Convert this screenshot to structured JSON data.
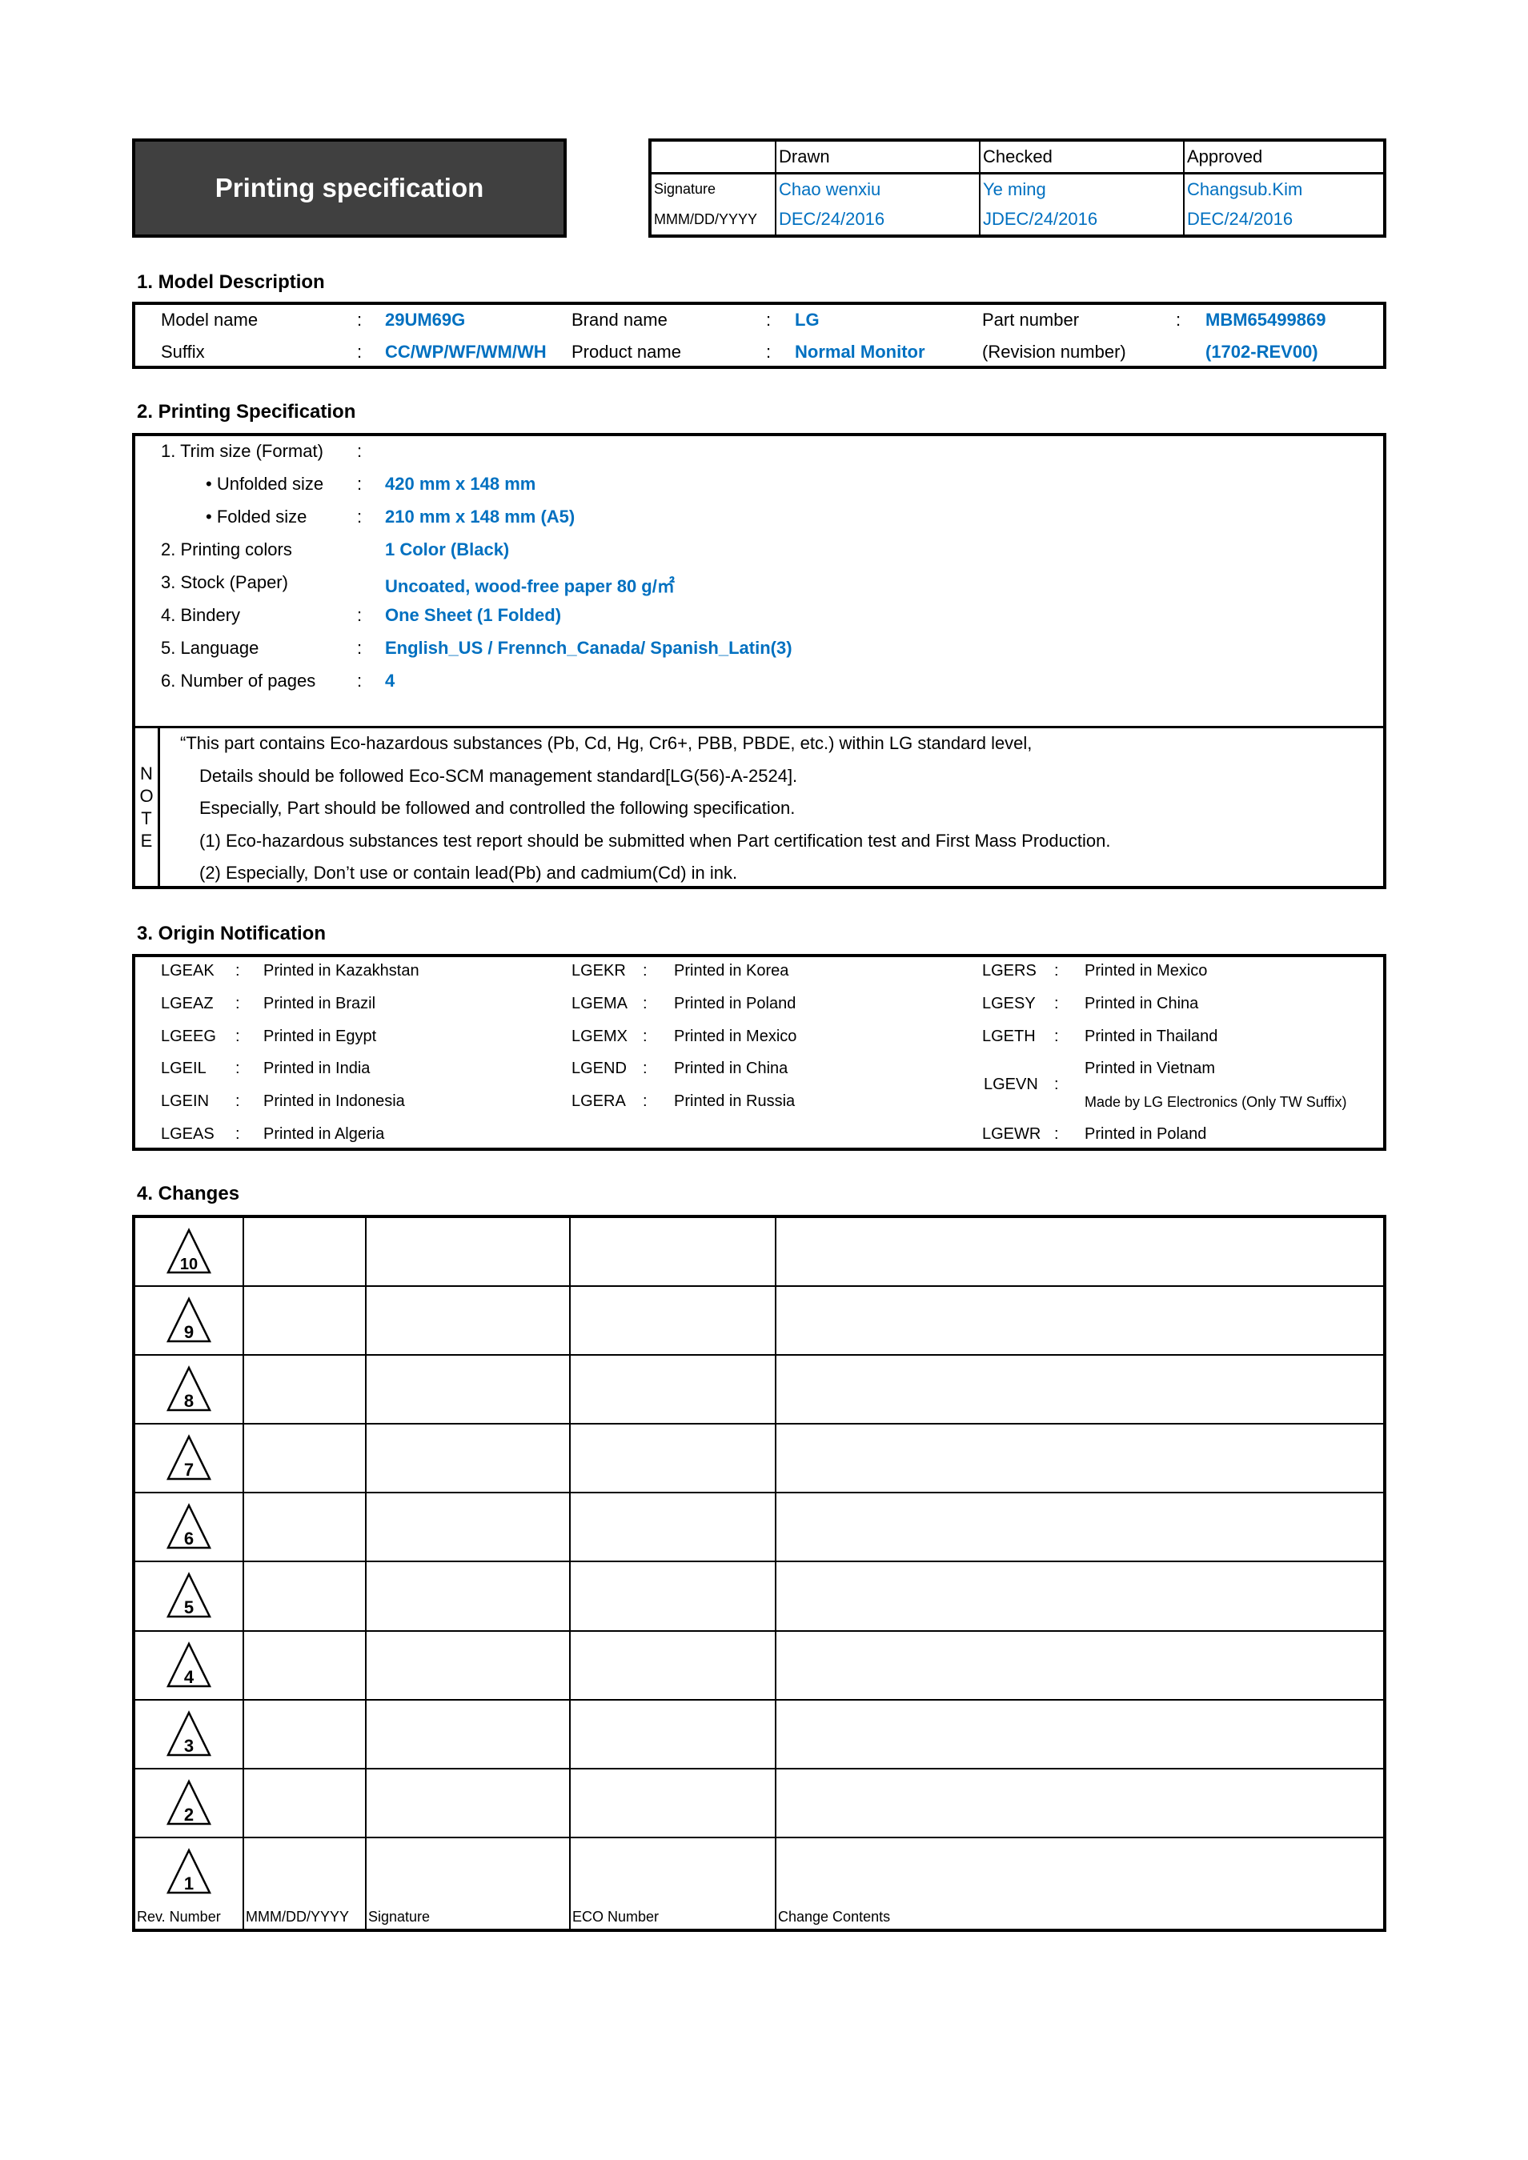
{
  "header": {
    "title": "Printing specification",
    "sign_table": {
      "columns": [
        "",
        "Drawn",
        "Checked",
        "Approved"
      ],
      "rows": [
        {
          "label": "Signature",
          "values": [
            "Chao wenxiu",
            "Ye ming",
            "Changsub.Kim"
          ]
        },
        {
          "label": "MMM/DD/YYYY",
          "values": [
            "DEC/24/2016",
            "JDEC/24/2016",
            "DEC/24/2016"
          ]
        }
      ]
    }
  },
  "model_description": {
    "heading": "1. Model Description",
    "rows": [
      [
        {
          "label": "Model name",
          "value": "29UM69G"
        },
        {
          "label": "Brand name",
          "value": "LG"
        },
        {
          "label": "Part number",
          "value": "MBM65499869"
        }
      ],
      [
        {
          "label": "Suffix",
          "value": "CC/WP/WF/WM/WH"
        },
        {
          "label": "Product name",
          "value": "Normal Monitor"
        },
        {
          "label": "(Revision number)",
          "value": "(1702-REV00)"
        }
      ]
    ]
  },
  "printing_spec": {
    "heading": "2. Printing Specification",
    "items": [
      {
        "label": "1. Trim size (Format)",
        "colon": ":",
        "value": ""
      },
      {
        "label": "• Unfolded size",
        "colon": ":",
        "value": "420 mm x 148 mm"
      },
      {
        "label": "• Folded size",
        "colon": ":",
        "value": "210 mm x 148 mm (A5)"
      },
      {
        "label": "2. Printing colors",
        "colon": "",
        "value": "1 Color (Black)"
      },
      {
        "label": "3. Stock (Paper)",
        "colon": "",
        "value": "Uncoated, wood-free paper 80 g/㎡"
      },
      {
        "label": "4. Bindery",
        "colon": ":",
        "value": "One Sheet (1 Folded)"
      },
      {
        "label": "5. Language",
        "colon": ":",
        "value": "English_US / Frennch_Canada/ Spanish_Latin(3)"
      },
      {
        "label": "6. Number of pages",
        "colon": ":",
        "value": "4"
      }
    ],
    "note": {
      "label_letters": [
        "N",
        "O",
        "T",
        "E"
      ],
      "lines": [
        "“This part contains Eco-hazardous substances (Pb, Cd, Hg, Cr6+, PBB, PBDE, etc.) within LG standard level,",
        "Details should be followed Eco-SCM management standard[LG(56)-A-2524].",
        "Especially, Part should be followed and controlled the following specification.",
        "(1) Eco-hazardous substances test report should be submitted when Part certification test and First Mass Production.",
        "(2) Especially, Don’t use or contain lead(Pb) and cadmium(Cd) in ink."
      ]
    }
  },
  "origin": {
    "heading": "3. Origin Notification",
    "columns": [
      [
        {
          "code": "LGEAK",
          "text": "Printed in Kazakhstan"
        },
        {
          "code": "LGEAZ",
          "text": "Printed in Brazil"
        },
        {
          "code": "LGEEG",
          "text": "Printed in Egypt"
        },
        {
          "code": "LGEIL",
          "text": "Printed in India"
        },
        {
          "code": "LGEIN",
          "text": "Printed in Indonesia"
        },
        {
          "code": "LGEAS",
          "text": "Printed in Algeria"
        }
      ],
      [
        {
          "code": "LGEKR",
          "text": "Printed in Korea"
        },
        {
          "code": "LGEMA",
          "text": "Printed in Poland"
        },
        {
          "code": "LGEMX",
          "text": "Printed in Mexico"
        },
        {
          "code": "LGEND",
          "text": "Printed in China"
        },
        {
          "code": "LGERA",
          "text": "Printed in Russia"
        }
      ],
      [
        {
          "code": "LGERS",
          "text": "Printed in Mexico"
        },
        {
          "code": "LGESY",
          "text": "Printed in China"
        },
        {
          "code": "LGETH",
          "text": "Printed in Thailand"
        },
        {
          "code": "LGEVN",
          "text": "Printed in Vietnam",
          "subtext": "Made by LG Electronics (Only TW Suffix)"
        },
        {
          "code": "LGEWR",
          "text": "Printed in Poland"
        }
      ]
    ]
  },
  "changes": {
    "heading": "4. Changes",
    "revisions": [
      "10",
      "9",
      "8",
      "7",
      "6",
      "5",
      "4",
      "3",
      "2",
      "1"
    ],
    "footer": [
      "Rev. Number",
      "MMM/DD/YYYY",
      "Signature",
      "ECO Number",
      "Change Contents"
    ]
  }
}
